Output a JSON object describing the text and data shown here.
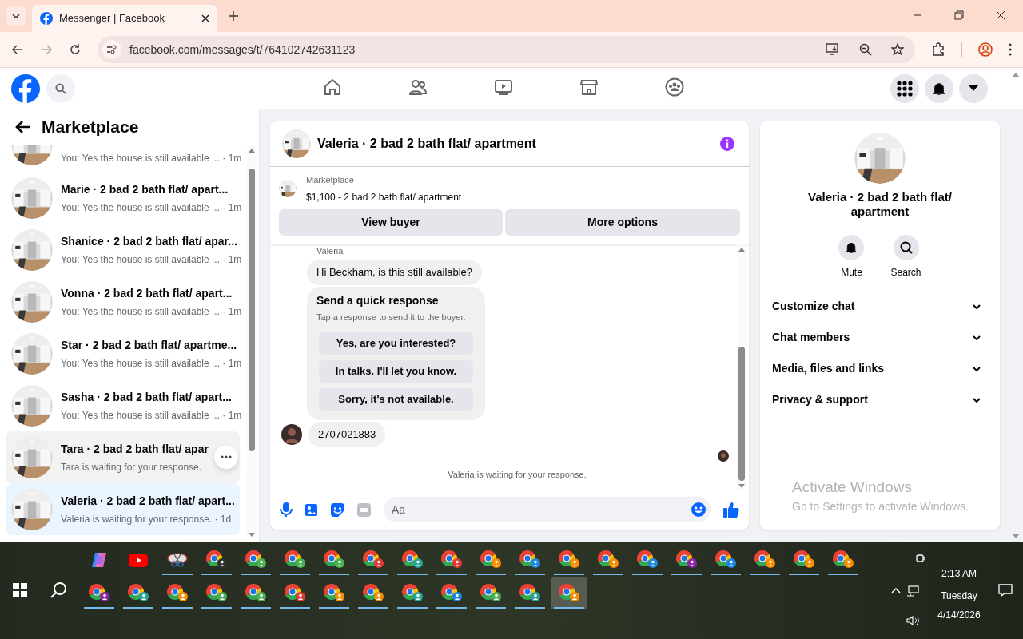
{
  "browser": {
    "tab": {
      "title": "Messenger | Facebook",
      "selected": true
    },
    "url": "facebook.com/messages/t/764102742631123"
  },
  "sidebar": {
    "title": "Marketplace",
    "conversations": [
      {
        "preview": "You: Yes the house is still available ... · 1m",
        "selected": false,
        "hovered": false
      },
      {
        "name": "Marie · 2 bad 2 bath flat/ apart...",
        "preview": "You: Yes the house is still available ... · 1m",
        "selected": false,
        "hovered": false
      },
      {
        "name": "Shanice · 2 bad 2 bath flat/ apar...",
        "preview": "You: Yes the house is still available ... · 1m",
        "selected": false,
        "hovered": false
      },
      {
        "name": "Vonna · 2 bad 2 bath flat/ apart...",
        "preview": "You: Yes the house is still available ... · 1m",
        "selected": false,
        "hovered": false
      },
      {
        "name": "Star · 2 bad 2 bath flat/ apartme...",
        "preview": "You: Yes the house is still available ... · 1m",
        "selected": false,
        "hovered": false
      },
      {
        "name": "Sasha · 2 bad 2 bath flat/ apart...",
        "preview": "You: Yes the house is still available ... · 1m",
        "selected": false,
        "hovered": false
      },
      {
        "name": "Tara · 2 bad 2 bath flat/ apar",
        "preview": "Tara is waiting for your response.",
        "selected": false,
        "hovered": true
      },
      {
        "name": "Valeria · 2 bad 2 bath flat/ apart...",
        "preview": "Valeria is waiting for your response. · 1d",
        "selected": true,
        "hovered": false
      }
    ]
  },
  "chat": {
    "title": "Valeria · 2 bad 2 bath flat/ apartment",
    "listing": {
      "label": "Marketplace",
      "title": "$1,100 - 2 bad 2 bath flat/ apartment"
    },
    "buttons": [
      "View buyer",
      "More options"
    ],
    "sender": "Valeria",
    "message": "Hi Beckham, is this still available?",
    "quick_response": {
      "title": "Send a quick response",
      "subtitle": "Tap a response to send it to the buyer.",
      "options": [
        "Yes, are you interested?",
        "In talks. I'll let you know.",
        "Sorry, it's not available."
      ]
    },
    "reply": "2707021883",
    "status": "Valeria is waiting for your response.",
    "composer": {
      "placeholder": "Aa"
    }
  },
  "details": {
    "title": "Valeria · 2 bad 2 bath flat/ apartment",
    "actions": [
      {
        "kind": "bell",
        "label": "Mute"
      },
      {
        "kind": "search",
        "label": "Search"
      }
    ],
    "sections": [
      {
        "label": "Customize chat",
        "expanded": false
      },
      {
        "label": "Chat members",
        "expanded": false
      },
      {
        "label": "Media, files and links",
        "expanded": false
      },
      {
        "label": "Privacy & support",
        "expanded": false
      }
    ]
  },
  "activation_notice": {
    "title": "Activate Windows",
    "text": "Go to Settings to activate Windows."
  },
  "taskbar": {
    "row_1": [
      {
        "kind": "copilot",
        "running": false,
        "active": false
      },
      {
        "kind": "youtube",
        "running": false,
        "active": false
      },
      {
        "kind": "snip",
        "running": true,
        "active": false
      },
      {
        "kind": "chrome",
        "color": "#333333",
        "running": true,
        "active": false
      },
      {
        "kind": "chrome",
        "color": "#4caf50",
        "running": true,
        "active": false
      },
      {
        "kind": "chrome",
        "color": "#4caf50",
        "running": true,
        "active": false
      },
      {
        "kind": "chrome",
        "color": "#4caf50",
        "running": true,
        "active": false
      },
      {
        "kind": "chrome",
        "color": "#e53935",
        "running": true,
        "active": false
      },
      {
        "kind": "chrome",
        "color": "#26a69a",
        "running": true,
        "active": false
      },
      {
        "kind": "chrome",
        "color": "#e53935",
        "running": true,
        "active": false
      },
      {
        "kind": "chrome",
        "color": "#fb8c00",
        "running": true,
        "active": false
      },
      {
        "kind": "chrome",
        "color": "#1e88e5",
        "running": true,
        "active": false
      },
      {
        "kind": "chrome",
        "color": "#fb8c00",
        "running": true,
        "active": false
      },
      {
        "kind": "chrome",
        "color": "#fb8c00",
        "running": true,
        "active": false
      },
      {
        "kind": "chrome",
        "color": "#1e88e5",
        "running": true,
        "active": false
      },
      {
        "kind": "chrome",
        "color": "#8e24aa",
        "running": true,
        "active": false
      },
      {
        "kind": "chrome",
        "color": "#1e88e5",
        "running": true,
        "active": false
      },
      {
        "kind": "chrome",
        "color": "#fb8c00",
        "running": true,
        "active": false
      },
      {
        "kind": "chrome",
        "color": "#fb8c00",
        "running": true,
        "active": false
      },
      {
        "kind": "chrome",
        "color": "#fb8c00",
        "running": true,
        "active": false
      }
    ],
    "row_2": [
      {
        "kind": "chrome",
        "color": "#8e24aa",
        "running": true,
        "active": false
      },
      {
        "kind": "chrome",
        "color": "#26a69a",
        "running": true,
        "active": false
      },
      {
        "kind": "chrome",
        "color": "#fb8c00",
        "running": true,
        "active": false
      },
      {
        "kind": "chrome",
        "color": "#4caf50",
        "running": true,
        "active": false
      },
      {
        "kind": "chrome",
        "color": "#4caf50",
        "running": true,
        "active": false
      },
      {
        "kind": "chrome",
        "color": "#e53935",
        "running": true,
        "active": false
      },
      {
        "kind": "chrome",
        "color": "#fb8c00",
        "running": true,
        "active": false
      },
      {
        "kind": "chrome",
        "color": "#fb8c00",
        "running": true,
        "active": false
      },
      {
        "kind": "chrome",
        "color": "#26a69a",
        "running": true,
        "active": false
      },
      {
        "kind": "chrome",
        "color": "#1e88e5",
        "running": true,
        "active": false
      },
      {
        "kind": "chrome",
        "color": "#4caf50",
        "running": true,
        "active": false
      },
      {
        "kind": "chrome",
        "color": "#26a69a",
        "running": true,
        "active": false
      },
      {
        "kind": "chrome",
        "color": "#fb8c00",
        "running": true,
        "active": true
      }
    ],
    "clock": {
      "time": "2:13 AM",
      "day": "Tuesday",
      "date": "4/14/2026"
    }
  }
}
